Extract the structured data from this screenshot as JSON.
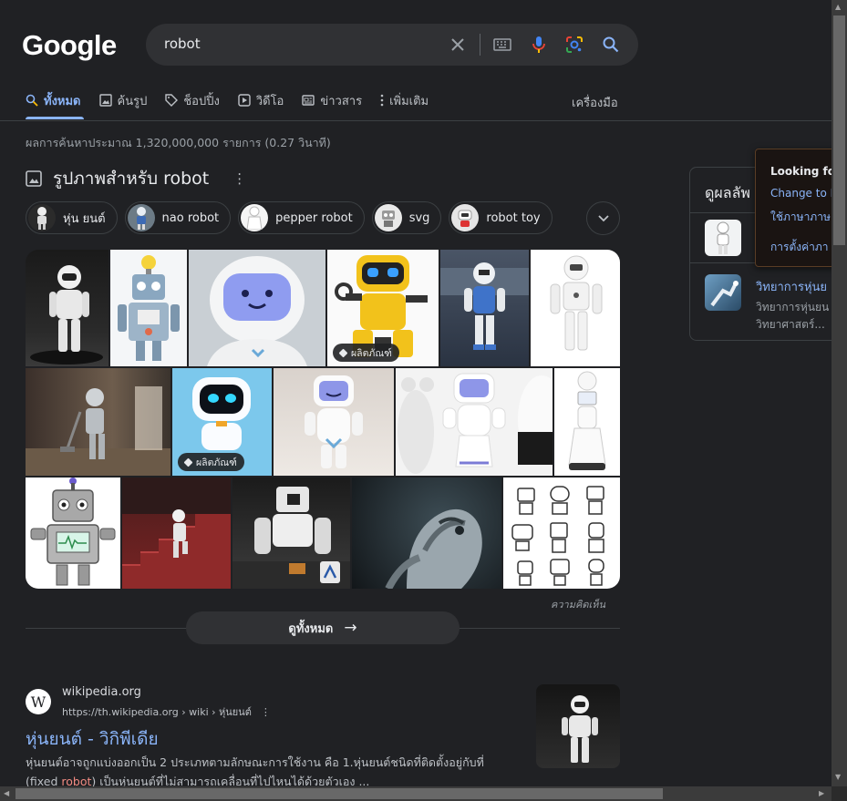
{
  "logo": "Google",
  "search": {
    "query": "robot"
  },
  "tabs": [
    {
      "label": "ทั้งหมด",
      "icon": "search-icon"
    },
    {
      "label": "ค้นรูป",
      "icon": "image-icon"
    },
    {
      "label": "ช็อปปิ้ง",
      "icon": "tag-icon"
    },
    {
      "label": "วิดีโอ",
      "icon": "play-icon"
    },
    {
      "label": "ข่าวสาร",
      "icon": "news-icon"
    },
    {
      "label": "เพิ่มเติม",
      "icon": "more-vert-icon"
    }
  ],
  "tools": "เครื่องมือ",
  "stats": "ผลการค้นหาประมาณ 1,320,000,000 รายการ (0.27 วินาที)",
  "images": {
    "title": "รูปภาพสำหรับ robot",
    "chips": [
      "หุ่น ยนต์",
      "nao robot",
      "pepper robot",
      "svg",
      "robot toy"
    ],
    "tag_product": "ผลิตภัณฑ์",
    "feedback": "ความคิดเห็น",
    "see_all": "ดูทั้งหมด"
  },
  "result": {
    "site": "wikipedia.org",
    "url": "https://th.wikipedia.org › wiki › หุ่นยนต์",
    "favicon": "W",
    "title": "หุ่นยนต์ - วิกิพีเดีย",
    "snippet_1": "หุ่นยนต์อาจถูกแบ่งออกเป็น 2 ประเภทตามลักษณะการใช้งาน คือ 1.หุ่นยนต์ชนิดที่ติดตั้งอยู่กับที่ (fixed ",
    "snippet_hl": "robot",
    "snippet_2": ") เป็นหุ่นยนต์ที่ไม่สามารถเคลื่อนที่ไปไหนได้ด้วยตัวเอง ..."
  },
  "knowledge_panel": {
    "heading": "ดูผลลัพ",
    "link_title": "วิทยาการหุ่นย",
    "line1": "วิทยาการหุ่นยน",
    "line2": "วิทยาศาสตร์..."
  },
  "popup": {
    "title": "Looking fo",
    "link1": "Change to E",
    "link2": "ใช้ภาษาภาษ",
    "link3": "การตั้งค่าภา"
  },
  "colors": {
    "accent": "#8ab4f8",
    "background": "#202124",
    "highlight": "#f28b82"
  }
}
